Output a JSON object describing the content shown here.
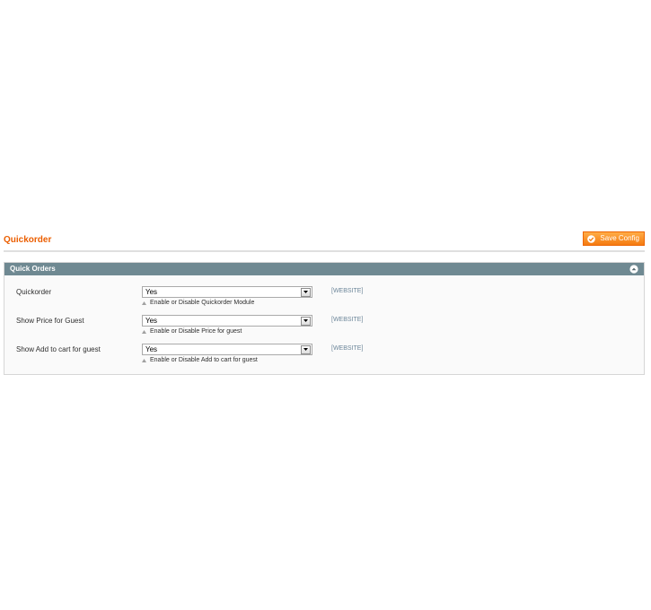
{
  "header": {
    "title": "Quickorder",
    "save_label": "Save Config",
    "accent_color": "#eb5e00"
  },
  "section": {
    "title": "Quick Orders",
    "header_color": "#6f8992"
  },
  "rows": [
    {
      "label": "Quickorder",
      "value": "Yes",
      "hint": "Enable or Disable Quickorder Module",
      "scope": "[WEBSITE]"
    },
    {
      "label": "Show Price for Guest",
      "value": "Yes",
      "hint": "Enable or Disable Price for guest",
      "scope": "[WEBSITE]"
    },
    {
      "label": "Show Add to cart for guest",
      "value": "Yes",
      "hint": "Enable or Disable Add to cart for guest",
      "scope": "[WEBSITE]"
    }
  ],
  "icons": {
    "save": "check-circle-icon",
    "collapse": "collapse-up-icon",
    "dropdown": "chevron-down-icon",
    "hint": "triangle-up-icon"
  }
}
